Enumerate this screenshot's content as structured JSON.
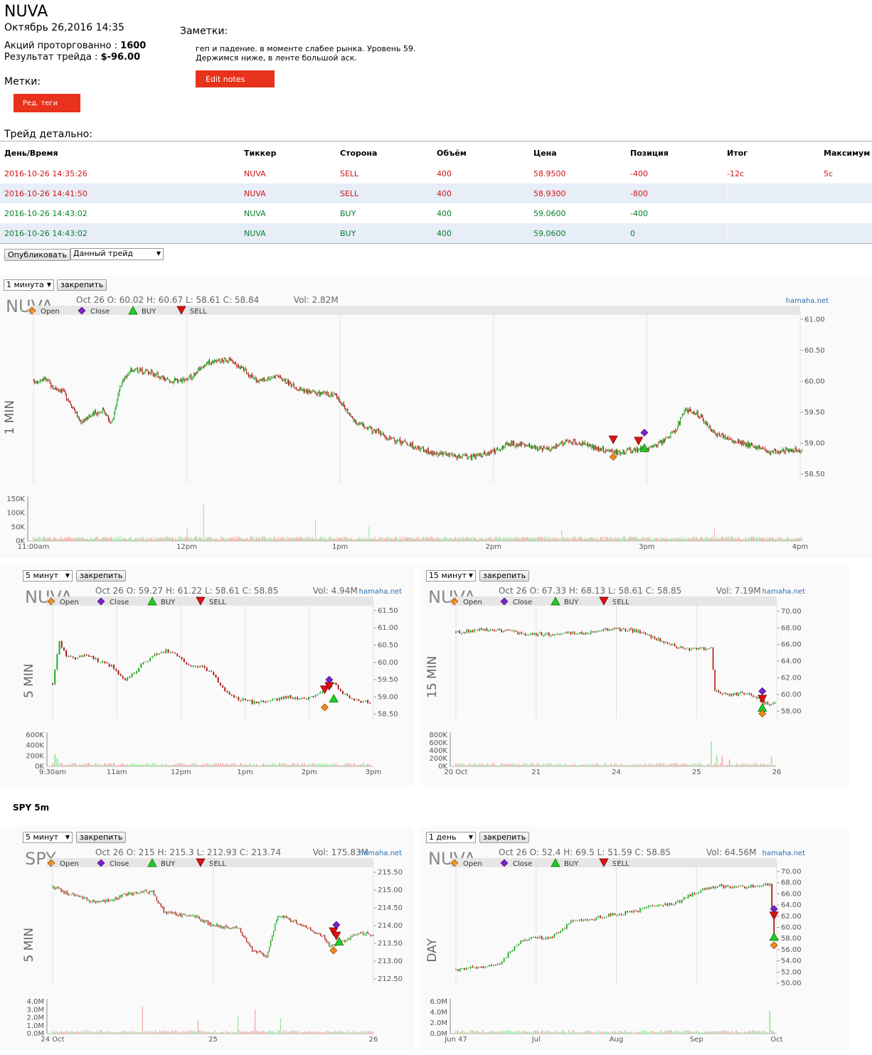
{
  "header": {
    "ticker": "NUVA",
    "datetime": "Октябрь 26,2016 14:35",
    "shares_label": "Акций проторгованно",
    "shares_value": "1600",
    "result_label": "Результат трейда",
    "result_value": "$-96.00",
    "colon": ":"
  },
  "notes": {
    "label": "Заметки:",
    "text": "геп и падение. в моменте слабее рынка. Уровень 59. Держимся ниже, в ленте большой аск.",
    "edit_button": "Edit notes"
  },
  "tags": {
    "label": "Метки:",
    "edit_button": "Ред. теги"
  },
  "trade_detail": {
    "label": "Трейд детально:",
    "columns": [
      "День/Время",
      "Тиккер",
      "Сторона",
      "Объём",
      "Цена",
      "Позиция",
      "Итог",
      "Максимум"
    ],
    "rows": [
      {
        "datetime": "2016-10-26 14:35:26",
        "ticker": "NUVA",
        "side": "SELL",
        "volume": "400",
        "price": "58.9500",
        "position": "-400",
        "result": "-12c",
        "max": "5c",
        "color": "red"
      },
      {
        "datetime": "2016-10-26 14:41:50",
        "ticker": "NUVA",
        "side": "SELL",
        "volume": "400",
        "price": "58.9300",
        "position": "-800",
        "result": "",
        "max": "",
        "color": "red"
      },
      {
        "datetime": "2016-10-26 14:43:02",
        "ticker": "NUVA",
        "side": "BUY",
        "volume": "400",
        "price": "59.0600",
        "position": "-400",
        "result": "",
        "max": "",
        "color": "green"
      },
      {
        "datetime": "2016-10-26 14:43:02",
        "ticker": "NUVA",
        "side": "BUY",
        "volume": "400",
        "price": "59.0600",
        "position": "0",
        "result": "",
        "max": "",
        "color": "green"
      }
    ]
  },
  "publish": {
    "button": "Опубликовать",
    "select_value": "Данный трейд"
  },
  "spy_section_title": "SPY 5m",
  "colors": {
    "up": "#1aa81a",
    "down": "#b01010",
    "vol_up": "#9be39b",
    "vol_down": "#f4a4a4",
    "sell": "#dd1111",
    "buy": "#22cc22",
    "open": "#f08a1c",
    "close": "#7a22cc",
    "accent": "#e8321c"
  },
  "chart_data": [
    {
      "id": "c1",
      "type": "candlestick",
      "interval_select": "1 минута",
      "pin_button": "закрепить",
      "symbol": "NUVA",
      "side_label": "1 MIN",
      "info": "Oct 26 O: 60.02 H: 60.67 L: 58.61 C: 58.84",
      "vol": "Vol: 2.82M",
      "brand": "hamaha.net",
      "legend": [
        "Open",
        "Close",
        "BUY",
        "SELL"
      ],
      "y_ticks": [
        "61.00",
        "60.50",
        "60.00",
        "59.50",
        "59.00",
        "58.50"
      ],
      "ylim": [
        58.35,
        61.05
      ],
      "vol_ticks": [
        "150K",
        "100K",
        "50K",
        "0K"
      ],
      "vol_max": 160,
      "x_ticks": [
        "11:00am",
        "12pm",
        "1pm",
        "2pm",
        "3pm",
        "4pm"
      ],
      "n": 300,
      "closes": [
        [
          0,
          60.0
        ],
        [
          12,
          60.05
        ],
        [
          20,
          59.9
        ],
        [
          30,
          59.85
        ],
        [
          40,
          59.6
        ],
        [
          48,
          59.35
        ],
        [
          60,
          59.45
        ],
        [
          72,
          59.55
        ],
        [
          80,
          59.3
        ],
        [
          90,
          59.95
        ],
        [
          100,
          60.2
        ],
        [
          120,
          60.15
        ],
        [
          140,
          60.0
        ],
        [
          160,
          60.05
        ],
        [
          180,
          60.3
        ],
        [
          200,
          60.35
        ],
        [
          215,
          60.2
        ],
        [
          230,
          60.0
        ],
        [
          250,
          60.1
        ],
        [
          270,
          59.9
        ],
        [
          290,
          59.8
        ],
        [
          310,
          59.8
        ],
        [
          330,
          59.35
        ],
        [
          350,
          59.2
        ],
        [
          370,
          59.05
        ],
        [
          390,
          58.95
        ],
        [
          410,
          58.85
        ],
        [
          430,
          58.8
        ],
        [
          450,
          58.78
        ],
        [
          470,
          58.85
        ],
        [
          490,
          59.0
        ],
        [
          510,
          58.95
        ],
        [
          530,
          58.9
        ],
        [
          550,
          59.05
        ],
        [
          570,
          58.95
        ],
        [
          600,
          58.85
        ],
        [
          620,
          58.9
        ],
        [
          640,
          58.95
        ],
        [
          660,
          59.2
        ],
        [
          670,
          59.55
        ],
        [
          685,
          59.45
        ],
        [
          700,
          59.15
        ],
        [
          720,
          59.05
        ],
        [
          740,
          58.95
        ],
        [
          760,
          58.85
        ],
        [
          780,
          58.9
        ],
        [
          790,
          58.85
        ]
      ],
      "spikes": [
        [
          158,
          50
        ],
        [
          175,
          140
        ],
        [
          290,
          80
        ],
        [
          345,
          55
        ],
        [
          543,
          40
        ],
        [
          700,
          45
        ]
      ],
      "markers": [
        {
          "t": "sell",
          "x": 596,
          "y": 59.05
        },
        {
          "t": "sell",
          "x": 622,
          "y": 59.03
        },
        {
          "t": "buy",
          "x": 628,
          "y": 58.92
        },
        {
          "t": "open",
          "x": 596,
          "y": 58.78
        },
        {
          "t": "close",
          "x": 628,
          "y": 59.17
        }
      ]
    },
    {
      "id": "c2",
      "type": "candlestick",
      "interval_select": "5 минут",
      "pin_button": "закрепить",
      "symbol": "NUVA",
      "side_label": "5 MIN",
      "info": "Oct 26 O: 59.27 H: 61.22 L: 58.61 C: 58.85",
      "vol": "Vol: 4.94M",
      "brand": "hamaha.net",
      "legend": [
        "Open",
        "Close",
        "BUY",
        "SELL"
      ],
      "y_ticks": [
        "61.50",
        "61.00",
        "60.50",
        "60.00",
        "59.50",
        "59.00",
        "58.50"
      ],
      "ylim": [
        58.35,
        61.6
      ],
      "vol_ticks": [
        "600K",
        "400K",
        "200K",
        "0K"
      ],
      "vol_max": 650,
      "x_ticks": [
        "9:30am",
        "11am",
        "12pm",
        "1pm",
        "2pm",
        "3pm"
      ],
      "n": 78,
      "closes": [
        [
          0,
          59.4
        ],
        [
          3,
          60.6
        ],
        [
          6,
          60.2
        ],
        [
          10,
          60.1
        ],
        [
          15,
          60.25
        ],
        [
          20,
          60.05
        ],
        [
          26,
          59.9
        ],
        [
          32,
          59.5
        ],
        [
          36,
          59.7
        ],
        [
          40,
          60.0
        ],
        [
          45,
          60.2
        ],
        [
          50,
          60.35
        ],
        [
          55,
          60.2
        ],
        [
          60,
          59.95
        ],
        [
          66,
          59.85
        ],
        [
          70,
          59.7
        ],
        [
          76,
          59.15
        ],
        [
          82,
          58.95
        ],
        [
          88,
          58.85
        ],
        [
          96,
          58.9
        ],
        [
          104,
          59.0
        ],
        [
          112,
          58.95
        ],
        [
          120,
          59.2
        ],
        [
          124,
          59.45
        ],
        [
          128,
          59.1
        ],
        [
          134,
          58.9
        ],
        [
          140,
          58.85
        ]
      ],
      "spikes": [
        [
          1,
          250
        ],
        [
          2,
          170
        ]
      ],
      "markers": [
        {
          "t": "sell",
          "x": 120,
          "y": 59.2
        },
        {
          "t": "sell",
          "x": 122,
          "y": 59.3
        },
        {
          "t": "buy",
          "x": 124,
          "y": 58.95
        },
        {
          "t": "open",
          "x": 120,
          "y": 58.7
        },
        {
          "t": "close",
          "x": 122,
          "y": 59.5
        }
      ]
    },
    {
      "id": "c3",
      "type": "candlestick",
      "interval_select": "15 минут",
      "pin_button": "закрепить",
      "symbol": "NUVA",
      "side_label": "15 MIN",
      "info": "Oct 26 O: 67.33 H: 68.13 L: 58.61 C: 58.85",
      "vol": "Vol: 7.19M",
      "brand": "hamaha.net",
      "legend": [
        "Open",
        "Close",
        "BUY",
        "SELL"
      ],
      "y_ticks": [
        "70.00",
        "68.00",
        "66.00",
        "64.00",
        "62.00",
        "60.00",
        "58.00"
      ],
      "ylim": [
        57.0,
        70.5
      ],
      "vol_ticks": [
        "800K",
        "600K",
        "400K",
        "200K",
        "0K"
      ],
      "vol_max": 900,
      "x_ticks": [
        "20 Oct",
        "21",
        "24",
        "25",
        "26"
      ],
      "n": 150,
      "closes": [
        [
          0,
          67.5
        ],
        [
          15,
          67.8
        ],
        [
          30,
          67.6
        ],
        [
          40,
          67.2
        ],
        [
          55,
          67.3
        ],
        [
          70,
          67.4
        ],
        [
          85,
          67.9
        ],
        [
          100,
          67.6
        ],
        [
          110,
          66.7
        ],
        [
          120,
          65.8
        ],
        [
          130,
          65.4
        ],
        [
          140,
          65.5
        ],
        [
          142,
          60.4
        ],
        [
          150,
          59.9
        ],
        [
          158,
          60.2
        ],
        [
          165,
          59.6
        ],
        [
          170,
          58.9
        ],
        [
          175,
          58.85
        ]
      ],
      "spikes": [
        [
          140,
          720
        ],
        [
          143,
          320
        ],
        [
          146,
          280
        ],
        [
          150,
          200
        ],
        [
          173,
          280
        ]
      ],
      "markers": [
        {
          "t": "sell",
          "x": 168,
          "y": 59.4
        },
        {
          "t": "buy",
          "x": 168,
          "y": 58.4
        },
        {
          "t": "open",
          "x": 168,
          "y": 57.7
        },
        {
          "t": "close",
          "x": 168,
          "y": 60.4
        }
      ]
    },
    {
      "id": "c4",
      "type": "candlestick",
      "interval_select": "5 минут",
      "pin_button": "закрепить",
      "symbol": "SPY",
      "side_label": "5 MIN",
      "info": "Oct 26 O: 215 H: 215.3 L: 212.93 C: 213.74",
      "vol": "Vol: 175.83M",
      "brand": "hamaha.net",
      "legend": [
        "Open",
        "Close",
        "BUY",
        "SELL"
      ],
      "y_ticks": [
        "215.50",
        "215.00",
        "214.50",
        "214.00",
        "213.50",
        "213.00",
        "212.50"
      ],
      "ylim": [
        212.3,
        215.6
      ],
      "vol_ticks": [
        "4.0M",
        "3.0M",
        "2.0M",
        "1.0M",
        "0.0M"
      ],
      "vol_max": 4.2,
      "x_ticks": [
        "24 Oct",
        "25",
        "26"
      ],
      "n": 230,
      "closes": [
        [
          0,
          215.1
        ],
        [
          10,
          214.9
        ],
        [
          20,
          214.8
        ],
        [
          30,
          214.65
        ],
        [
          40,
          214.7
        ],
        [
          50,
          214.85
        ],
        [
          60,
          214.95
        ],
        [
          70,
          214.95
        ],
        [
          78,
          214.4
        ],
        [
          90,
          214.3
        ],
        [
          100,
          214.25
        ],
        [
          110,
          214.05
        ],
        [
          120,
          213.95
        ],
        [
          130,
          213.95
        ],
        [
          140,
          213.3
        ],
        [
          150,
          213.15
        ],
        [
          158,
          214.3
        ],
        [
          170,
          214.1
        ],
        [
          180,
          213.9
        ],
        [
          190,
          213.7
        ],
        [
          195,
          213.4
        ],
        [
          205,
          213.6
        ],
        [
          215,
          213.8
        ],
        [
          225,
          213.75
        ]
      ],
      "spikes": [
        [
          63,
          3.6
        ],
        [
          102,
          1.7
        ],
        [
          130,
          2.3
        ],
        [
          142,
          3.2
        ],
        [
          160,
          2.0
        ]
      ],
      "markers": [
        {
          "t": "sell",
          "x": 197,
          "y": 213.82
        },
        {
          "t": "sell",
          "x": 199,
          "y": 213.7
        },
        {
          "t": "buy",
          "x": 201,
          "y": 213.55
        },
        {
          "t": "open",
          "x": 197,
          "y": 213.3
        },
        {
          "t": "close",
          "x": 199,
          "y": 214.02
        }
      ]
    },
    {
      "id": "c5",
      "type": "candlestick",
      "interval_select": "1 день",
      "pin_button": "закрепить",
      "symbol": "NUVA",
      "side_label": "DAY",
      "info": "Oct 26 O: 52.4 H: 69.5 L: 51.59 C: 58.85",
      "vol": "Vol: 64.56M",
      "brand": "hamaha.net",
      "legend": [
        "Open",
        "Close",
        "BUY",
        "SELL"
      ],
      "y_ticks": [
        "70.00",
        "68.00",
        "66.00",
        "64.00",
        "62.00",
        "60.00",
        "58.00",
        "56.00",
        "54.00",
        "52.00",
        "50.00"
      ],
      "ylim": [
        49.5,
        70.5
      ],
      "vol_ticks": [
        "6.0M",
        "4.0M",
        "2.0M",
        "0.0M"
      ],
      "vol_max": 6.5,
      "x_ticks": [
        "Jun 47",
        "Jul",
        "Aug",
        "Sep",
        "Oct"
      ],
      "n": 100,
      "closes": [
        [
          0,
          52.3
        ],
        [
          10,
          52.8
        ],
        [
          20,
          53.2
        ],
        [
          30,
          57.3
        ],
        [
          35,
          58.1
        ],
        [
          45,
          58.0
        ],
        [
          55,
          61.0
        ],
        [
          65,
          61.5
        ],
        [
          75,
          62.3
        ],
        [
          85,
          62.8
        ],
        [
          95,
          63.8
        ],
        [
          105,
          64.4
        ],
        [
          115,
          66.3
        ],
        [
          125,
          67.4
        ],
        [
          135,
          67.2
        ],
        [
          145,
          67.5
        ],
        [
          150,
          67.7
        ],
        [
          152,
          58.85
        ]
      ],
      "spikes": [
        [
          150,
          4.6
        ]
      ],
      "markers": [
        {
          "t": "sell",
          "x": 152,
          "y": 62.0
        },
        {
          "t": "close",
          "x": 152,
          "y": 63.3
        },
        {
          "t": "buy",
          "x": 152,
          "y": 58.3
        },
        {
          "t": "open",
          "x": 152,
          "y": 56.8
        }
      ]
    }
  ]
}
